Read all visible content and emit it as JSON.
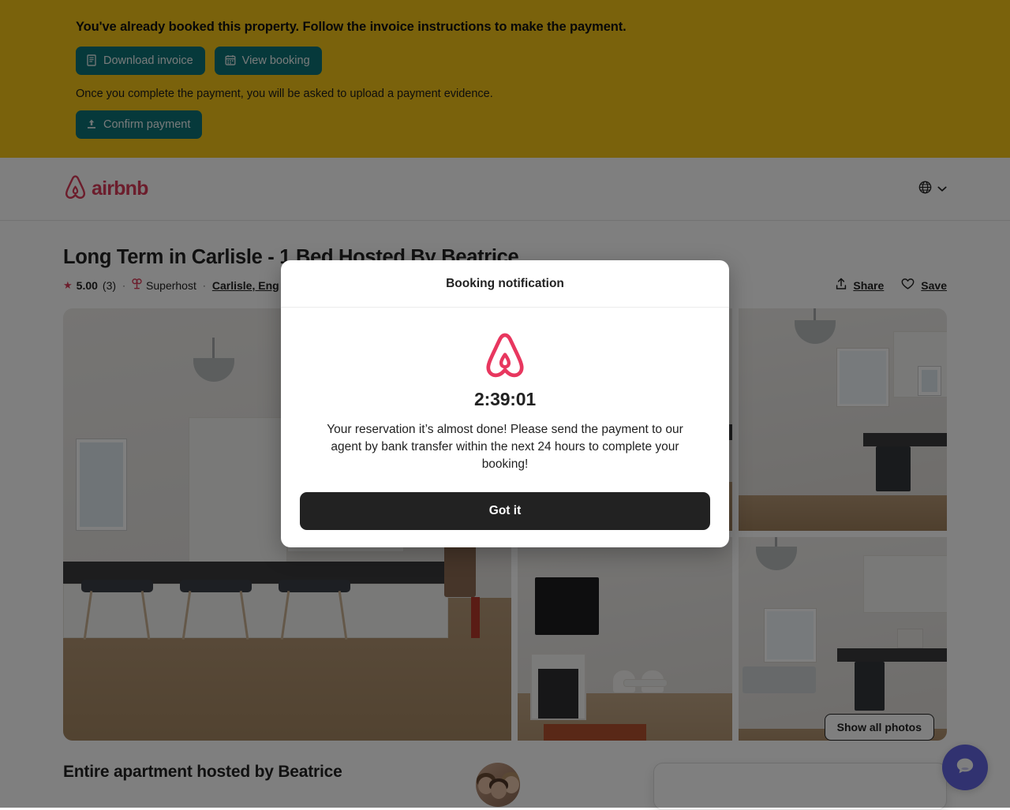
{
  "banner": {
    "message": "You've already booked this property. Follow the invoice instructions to make the payment.",
    "download_invoice_label": "Download invoice",
    "view_booking_label": "View booking",
    "sub_message": "Once you complete the payment, you will be asked to upload a payment evidence.",
    "confirm_payment_label": "Confirm payment",
    "background_color": "#f5c518",
    "button_color": "#0d7377"
  },
  "header": {
    "logo_text": "airbnb",
    "logo_color": "#d93b58",
    "language_icon": "globe-icon",
    "chevron_icon": "chevron-down-icon"
  },
  "listing": {
    "title": "Long Term in Carlisle - 1 Bed Hosted By Beatrice",
    "rating": "5.00",
    "review_count": "(3)",
    "superhost_label": "Superhost",
    "location": "Carlisle, Eng",
    "separator": "·",
    "share_label": "Share",
    "save_label": "Save",
    "show_all_photos_label": "Show all photos"
  },
  "host_section": {
    "title": "Entire apartment hosted by Beatrice"
  },
  "modal": {
    "title": "Booking notification",
    "logo_icon": "airbnb-belo-icon",
    "logo_color": "#e8375f",
    "timer": "2:39:01",
    "message": "Your reservation it’s almost done! Please send the payment to our agent by bank transfer within the next 24 hours to complete your booking!",
    "confirm_label": "Got it",
    "confirm_color": "#222222"
  },
  "chat": {
    "icon": "chat-bubble-icon",
    "color": "#6264e0"
  }
}
